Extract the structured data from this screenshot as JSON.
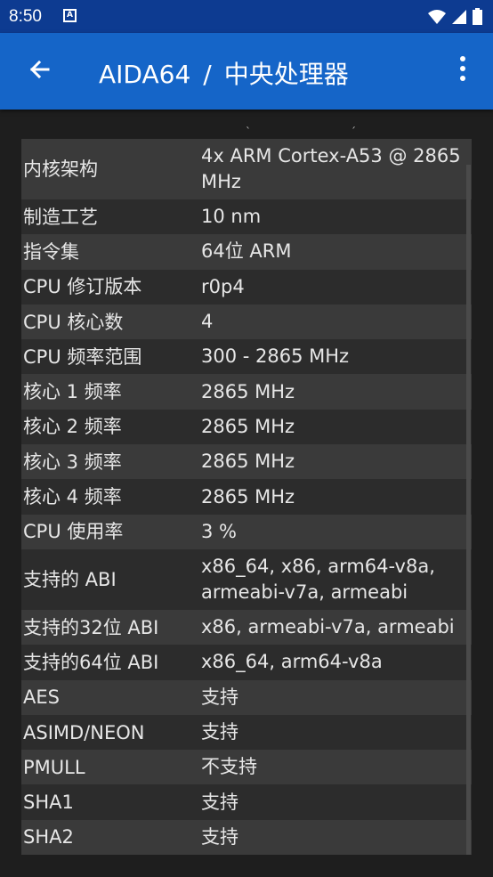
{
  "status_bar": {
    "time": "8:50",
    "notification_icon": "A"
  },
  "app_bar": {
    "app_name": "AIDA64",
    "separator": "/",
    "section": "中央处理器"
  },
  "rows": [
    {
      "label": "内核架构",
      "value": "4x ARM Cortex-A53 @ 2865 MHz",
      "lines": 2
    },
    {
      "label": "制造工艺",
      "value": "10 nm",
      "lines": 1
    },
    {
      "label": "指令集",
      "value": "64位 ARM",
      "lines": 1
    },
    {
      "label": "CPU 修订版本",
      "value": "r0p4",
      "lines": 1
    },
    {
      "label": "CPU 核心数",
      "value": "4",
      "lines": 1
    },
    {
      "label": "CPU 频率范围",
      "value": "300 - 2865 MHz",
      "lines": 1
    },
    {
      "label": "核心 1 频率",
      "value": "2865 MHz",
      "lines": 1
    },
    {
      "label": "核心 2 频率",
      "value": "2865 MHz",
      "lines": 1
    },
    {
      "label": "核心 3 频率",
      "value": "2865 MHz",
      "lines": 1
    },
    {
      "label": "核心 4 频率",
      "value": "2865 MHz",
      "lines": 1
    },
    {
      "label": "CPU 使用率",
      "value": "3 %",
      "lines": 1
    },
    {
      "label": "支持的 ABI",
      "value": "x86_64, x86, arm64-v8a, armeabi-v7a, armeabi",
      "lines": 2
    },
    {
      "label": "支持的32位 ABI",
      "value": "x86, armeabi-v7a, armeabi",
      "lines": 1
    },
    {
      "label": "支持的64位 ABI",
      "value": "x86_64, arm64-v8a",
      "lines": 1
    },
    {
      "label": "AES",
      "value": "支持",
      "lines": 1
    },
    {
      "label": "ASIMD/NEON",
      "value": "支持",
      "lines": 1
    },
    {
      "label": "PMULL",
      "value": "不支持",
      "lines": 1
    },
    {
      "label": "SHA1",
      "value": "支持",
      "lines": 1
    },
    {
      "label": "SHA2",
      "value": "支持",
      "lines": 1
    }
  ]
}
